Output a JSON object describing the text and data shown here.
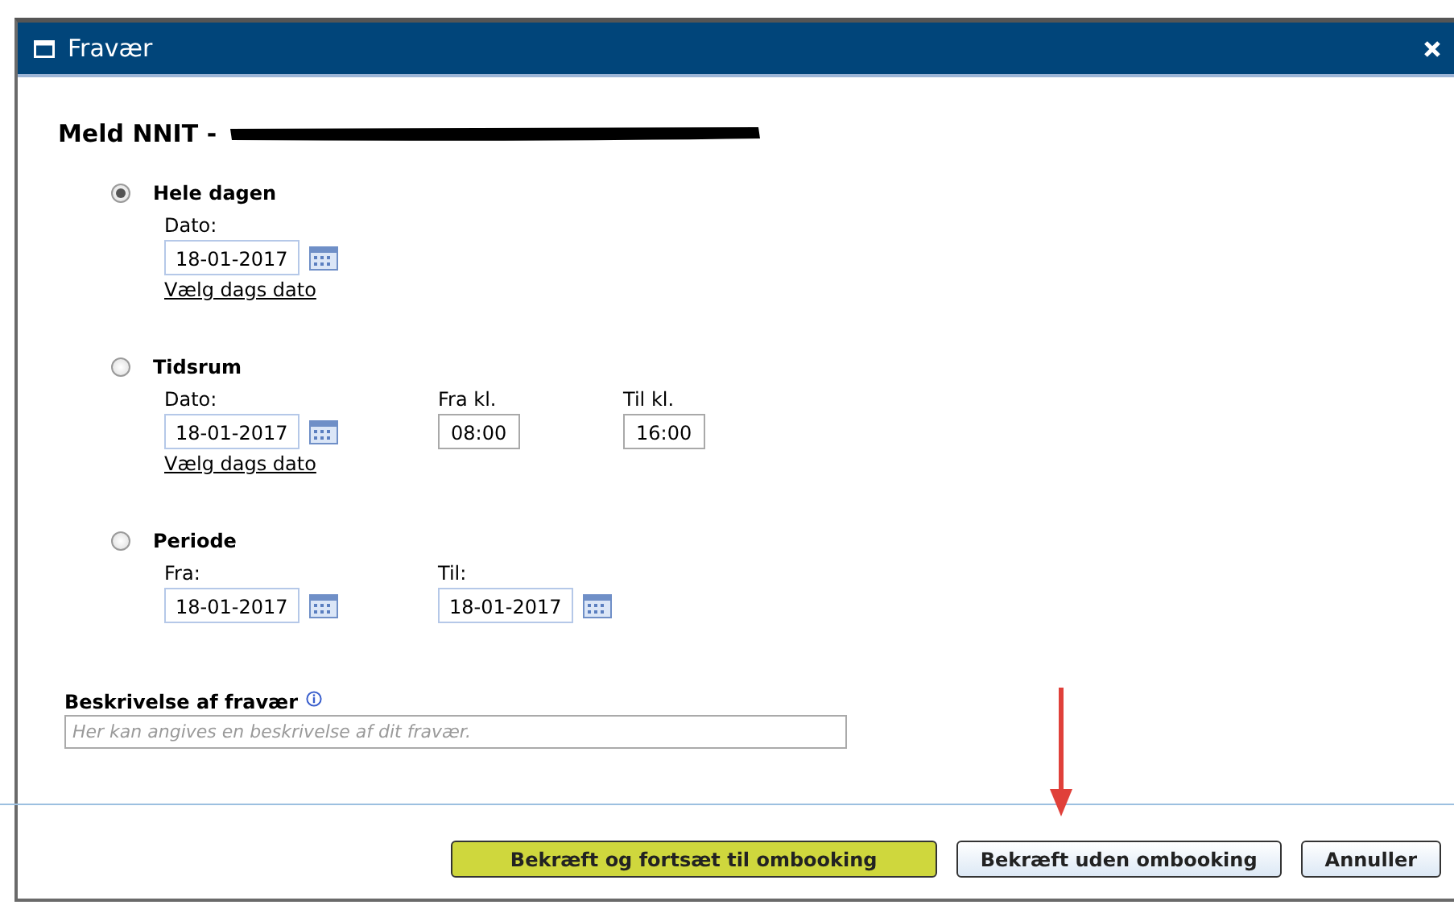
{
  "window": {
    "title": "Fravær"
  },
  "heading": {
    "text": "Meld NNIT -",
    "redacted": true
  },
  "options": [
    {
      "label": "Hele dagen",
      "selected": true,
      "fields": [
        {
          "kind": "date",
          "label": "Dato:",
          "value": "18-01-2017",
          "link": "Vælg dags dato"
        }
      ]
    },
    {
      "label": "Tidsrum",
      "selected": false,
      "fields": [
        {
          "kind": "date",
          "label": "Dato:",
          "value": "18-01-2017",
          "link": "Vælg dags dato"
        },
        {
          "kind": "time",
          "label": "Fra kl.",
          "value": "08:00"
        },
        {
          "kind": "time",
          "label": "Til kl.",
          "value": "16:00"
        }
      ]
    },
    {
      "label": "Periode",
      "selected": false,
      "fields": [
        {
          "kind": "date",
          "label": "Fra:",
          "value": "18-01-2017"
        },
        {
          "kind": "date",
          "label": "Til:",
          "value": "18-01-2017"
        }
      ]
    }
  ],
  "description": {
    "label": "Beskrivelse af fravær",
    "placeholder": "Her kan angives en beskrivelse af dit fravær."
  },
  "buttons": [
    {
      "label": "Bekræft og fortsæt til ombooking",
      "kind": "primary"
    },
    {
      "label": "Bekræft uden ombooking",
      "kind": "default"
    },
    {
      "label": "Annuller",
      "kind": "default"
    }
  ],
  "annotation": {
    "kind": "arrow"
  }
}
